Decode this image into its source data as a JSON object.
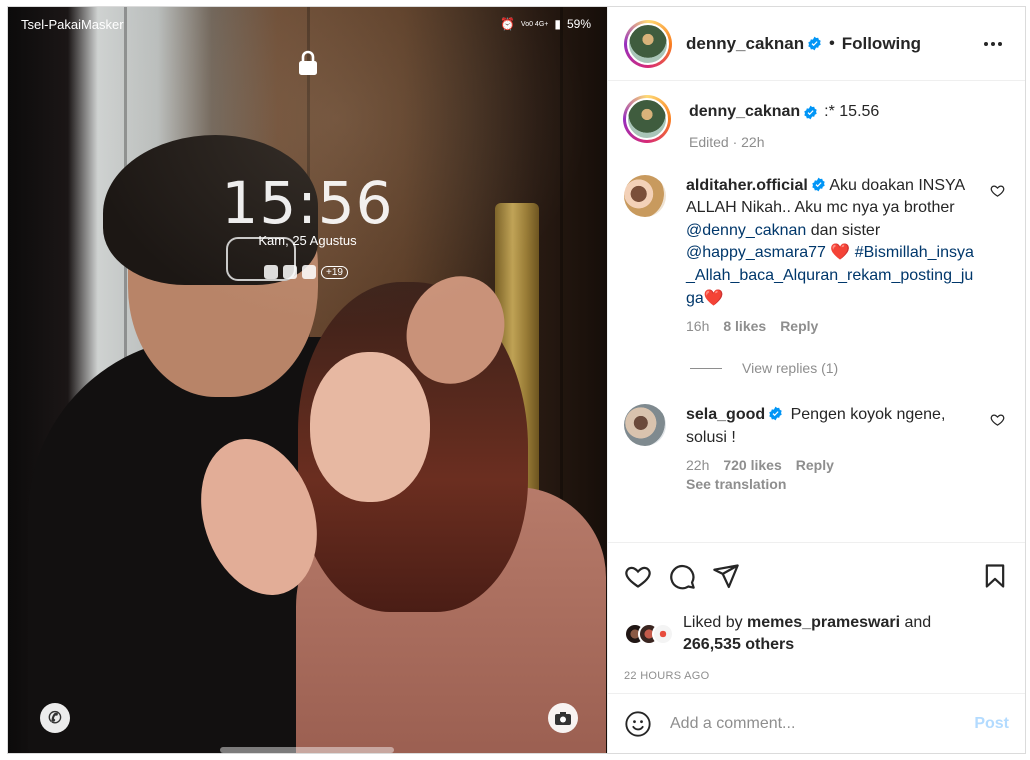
{
  "photo": {
    "lockscreen": {
      "carrier": "Tsel-PakaiMasker",
      "status_battery": "59%",
      "status_network": "Vo0 4G+",
      "time": "15:56",
      "date": "Kam, 25 Agustus",
      "notif_more": "+19"
    }
  },
  "header": {
    "username": "denny_caknan",
    "separator": "•",
    "follow_label": "Following"
  },
  "caption": {
    "username": "denny_caknan",
    "text": ":* 15.56",
    "meta": "Edited · 22h"
  },
  "comments": [
    {
      "username": "alditaher.official",
      "text_1": "Aku doakan INSYA ALLAH Nikah.. Aku mc nya ya brother ",
      "mention_1": "@denny_caknan",
      "text_2": " dan sister ",
      "mention_2": "@happy_asmara77",
      "text_3": " ❤️ ",
      "mention_3": "#Bismillah_insya_Allah_baca_Alquran_rekam_posting_juga",
      "text_4": "❤️",
      "time": "16h",
      "likes": "8 likes",
      "reply": "Reply",
      "view_replies": "View replies (1)"
    },
    {
      "username": "sela_good",
      "text": "Pengen koyok ngene, solusi !",
      "time": "22h",
      "likes": "720 likes",
      "reply": "Reply",
      "translate": "See translation"
    }
  ],
  "likes": {
    "prefix": "Liked by ",
    "user": "memes_prameswari",
    "mid": " and",
    "others": "266,535 others"
  },
  "timestamp": "22 HOURS AGO",
  "add_comment": {
    "placeholder": "Add a comment...",
    "post_label": "Post"
  },
  "colors": {
    "verified": "#0095f6",
    "mention": "#00376b",
    "muted": "#8e8e8e",
    "post_disabled": "#b3dbff"
  }
}
